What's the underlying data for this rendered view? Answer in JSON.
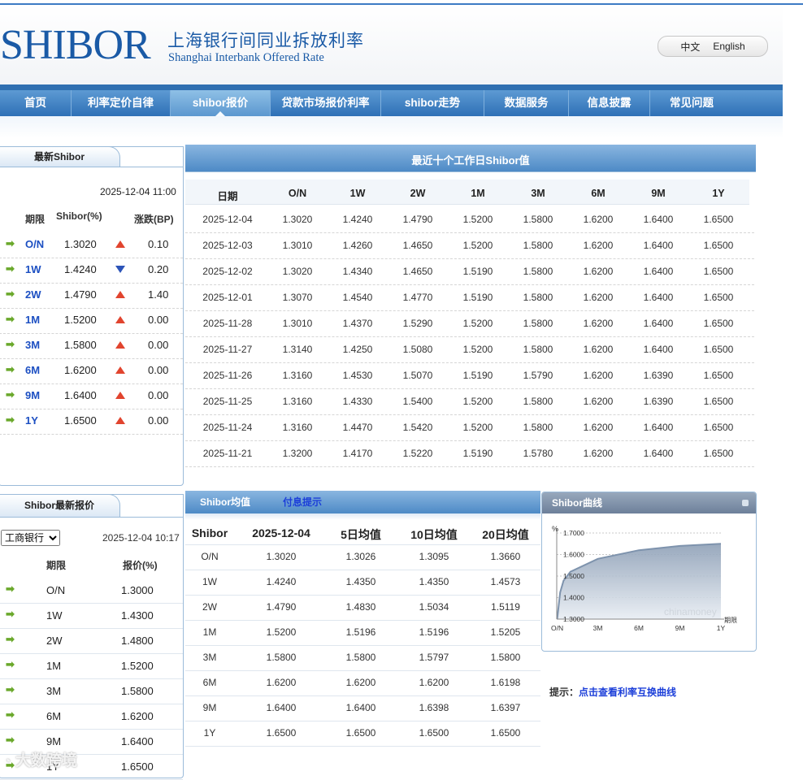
{
  "header": {
    "logo": "SHIBOR",
    "cn_title": "上海银行间同业拆放利率",
    "en_title": "Shanghai Interbank Offered Rate",
    "lang": [
      "中文",
      "English"
    ]
  },
  "nav": [
    "首页",
    "利率定价自律",
    "shibor报价",
    "贷款市场报价利率",
    "shibor走势",
    "数据服务",
    "信息披露",
    "常见问题"
  ],
  "latest": {
    "tab": "最新Shibor",
    "datetime": "2025-12-04 11:00",
    "headers": [
      "期限",
      "Shibor(%)",
      "涨跌(BP)"
    ],
    "rows": [
      {
        "term": "O/N",
        "rate": "1.3020",
        "dir": "up",
        "bp": "0.10"
      },
      {
        "term": "1W",
        "rate": "1.4240",
        "dir": "down",
        "bp": "0.20"
      },
      {
        "term": "2W",
        "rate": "1.4790",
        "dir": "up",
        "bp": "1.40"
      },
      {
        "term": "1M",
        "rate": "1.5200",
        "dir": "up",
        "bp": "0.00"
      },
      {
        "term": "3M",
        "rate": "1.5800",
        "dir": "up",
        "bp": "0.00"
      },
      {
        "term": "6M",
        "rate": "1.6200",
        "dir": "up",
        "bp": "0.00"
      },
      {
        "term": "9M",
        "rate": "1.6400",
        "dir": "up",
        "bp": "0.00"
      },
      {
        "term": "1Y",
        "rate": "1.6500",
        "dir": "up",
        "bp": "0.00"
      }
    ]
  },
  "ten_day": {
    "title": "最近十个工作日Shibor值",
    "headers": [
      "日期",
      "O/N",
      "1W",
      "2W",
      "1M",
      "3M",
      "6M",
      "9M",
      "1Y"
    ],
    "rows": [
      [
        "2025-12-04",
        "1.3020",
        "1.4240",
        "1.4790",
        "1.5200",
        "1.5800",
        "1.6200",
        "1.6400",
        "1.6500"
      ],
      [
        "2025-12-03",
        "1.3010",
        "1.4260",
        "1.4650",
        "1.5200",
        "1.5800",
        "1.6200",
        "1.6400",
        "1.6500"
      ],
      [
        "2025-12-02",
        "1.3020",
        "1.4340",
        "1.4650",
        "1.5190",
        "1.5800",
        "1.6200",
        "1.6400",
        "1.6500"
      ],
      [
        "2025-12-01",
        "1.3070",
        "1.4540",
        "1.4770",
        "1.5190",
        "1.5800",
        "1.6200",
        "1.6400",
        "1.6500"
      ],
      [
        "2025-11-28",
        "1.3010",
        "1.4370",
        "1.5290",
        "1.5200",
        "1.5800",
        "1.6200",
        "1.6400",
        "1.6500"
      ],
      [
        "2025-11-27",
        "1.3140",
        "1.4250",
        "1.5080",
        "1.5200",
        "1.5800",
        "1.6200",
        "1.6400",
        "1.6500"
      ],
      [
        "2025-11-26",
        "1.3160",
        "1.4530",
        "1.5070",
        "1.5190",
        "1.5790",
        "1.6200",
        "1.6390",
        "1.6500"
      ],
      [
        "2025-11-25",
        "1.3160",
        "1.4330",
        "1.5400",
        "1.5200",
        "1.5800",
        "1.6200",
        "1.6390",
        "1.6500"
      ],
      [
        "2025-11-24",
        "1.3160",
        "1.4470",
        "1.5420",
        "1.5200",
        "1.5800",
        "1.6200",
        "1.6400",
        "1.6500"
      ],
      [
        "2025-11-21",
        "1.3200",
        "1.4170",
        "1.5220",
        "1.5190",
        "1.5780",
        "1.6200",
        "1.6400",
        "1.6500"
      ]
    ]
  },
  "quotes": {
    "tab": "Shibor最新报价",
    "bank_selected": "工商银行",
    "datetime": "2025-12-04 10:17",
    "headers": [
      "期限",
      "报价(%)"
    ],
    "rows": [
      [
        "O/N",
        "1.3000"
      ],
      [
        "1W",
        "1.4300"
      ],
      [
        "2W",
        "1.4800"
      ],
      [
        "1M",
        "1.5200"
      ],
      [
        "3M",
        "1.5800"
      ],
      [
        "6M",
        "1.6200"
      ],
      [
        "9M",
        "1.6400"
      ],
      [
        "1Y",
        "1.6500"
      ]
    ]
  },
  "avg": {
    "tab1": "Shibor均值",
    "tab2": "付息提示",
    "headers": [
      "Shibor",
      "2025-12-04",
      "5日均值",
      "10日均值",
      "20日均值"
    ],
    "rows": [
      [
        "O/N",
        "1.3020",
        "1.3026",
        "1.3095",
        "1.3660"
      ],
      [
        "1W",
        "1.4240",
        "1.4350",
        "1.4350",
        "1.4573"
      ],
      [
        "2W",
        "1.4790",
        "1.4830",
        "1.5034",
        "1.5119"
      ],
      [
        "1M",
        "1.5200",
        "1.5196",
        "1.5196",
        "1.5205"
      ],
      [
        "3M",
        "1.5800",
        "1.5800",
        "1.5797",
        "1.5800"
      ],
      [
        "6M",
        "1.6200",
        "1.6200",
        "1.6200",
        "1.6198"
      ],
      [
        "9M",
        "1.6400",
        "1.6400",
        "1.6398",
        "1.6397"
      ],
      [
        "1Y",
        "1.6500",
        "1.6500",
        "1.6500",
        "1.6500"
      ]
    ]
  },
  "curve": {
    "title": "Shibor曲线",
    "watermark": "chinamoney",
    "tip_label": "提示：",
    "tip_link": "点击查看利率互换曲线"
  },
  "chart_data": {
    "type": "area",
    "x": [
      "O/N",
      "1W",
      "2W",
      "1M",
      "3M",
      "6M",
      "9M",
      "1Y"
    ],
    "x_ticks": [
      "O/N",
      "3M",
      "6M",
      "9M",
      "1Y"
    ],
    "values": [
      1.302,
      1.424,
      1.479,
      1.52,
      1.58,
      1.62,
      1.64,
      1.65
    ],
    "ylabel": "%",
    "xlabel": "期限",
    "y_ticks": [
      "1.3000",
      "1.4000",
      "1.5000",
      "1.6000",
      "1.7000"
    ],
    "ylim": [
      1.3,
      1.7
    ],
    "grid": true,
    "line_color": "#7e93ad"
  },
  "watermark": "大数跨境"
}
